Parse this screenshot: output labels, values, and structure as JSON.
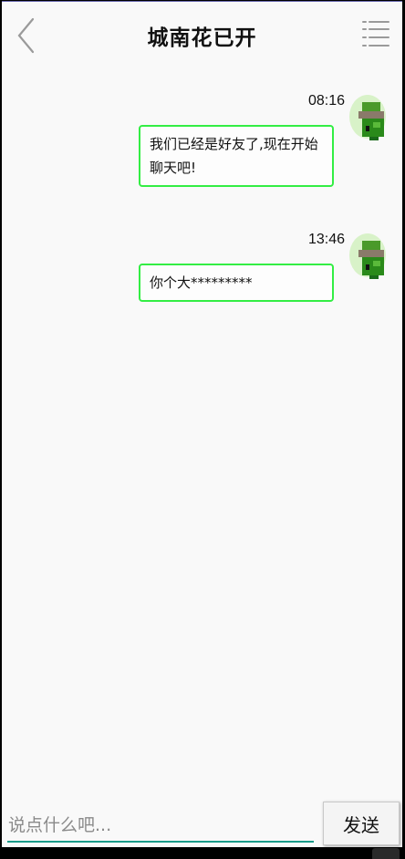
{
  "header": {
    "title": "城南花已开",
    "back_icon": "chevron-left-icon",
    "menu_icon": "list-menu-icon"
  },
  "messages": [
    {
      "time": "08:16",
      "text": "我们已经是好友了,现在开始聊天吧!"
    },
    {
      "time": "13:46",
      "text": "你个大*********"
    }
  ],
  "composer": {
    "placeholder": "说点什么吧...",
    "value": "",
    "send_label": "发送"
  },
  "colors": {
    "bubble_border": "#33ee44",
    "input_underline": "#1a9a8a",
    "background": "#f9f9f9"
  }
}
